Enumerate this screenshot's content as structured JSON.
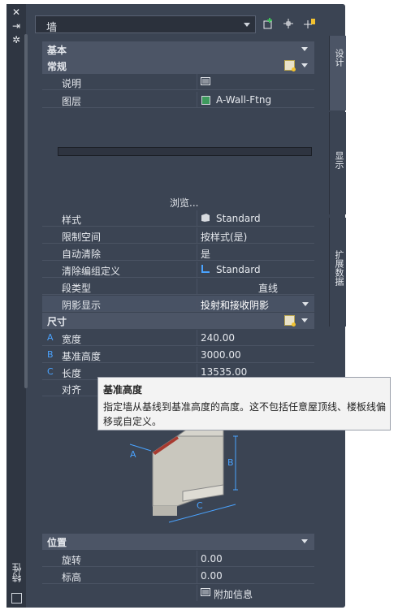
{
  "palette": {
    "title_vertical": "特性",
    "selector": "墙",
    "tabs": [
      "设计",
      "显示",
      "扩展数据"
    ]
  },
  "sections": {
    "basic": "基本",
    "general": "常规",
    "dimensions": "尺寸",
    "location": "位置"
  },
  "general_rows": {
    "description": {
      "key": "说明",
      "value": ""
    },
    "layer": {
      "key": "图层",
      "value": "A-Wall-Ftng"
    },
    "browse": "浏览...",
    "style": {
      "key": "样式",
      "value": "Standard"
    },
    "bound_spaces": {
      "key": "限制空间",
      "value": "按样式(是)"
    },
    "cleanup": {
      "key": "自动清除",
      "value": "是"
    },
    "cleanup_group": {
      "key": "清除编组定义",
      "value": "Standard"
    },
    "segment_type": {
      "key": "段类型",
      "value": "直线"
    },
    "shadow": {
      "key": "阴影显示",
      "value": "投射和接收阴影"
    }
  },
  "dimension_rows": {
    "width": {
      "letter": "A",
      "key": "宽度",
      "value": "240.00"
    },
    "base_height": {
      "letter": "B",
      "key": "基准高度",
      "value": "3000.00"
    },
    "length": {
      "letter": "C",
      "key": "长度",
      "value": "13535.00"
    },
    "justify": {
      "key": "对齐",
      "value": ""
    }
  },
  "location_rows": {
    "rotation": {
      "key": "旋转",
      "value": "0.00"
    },
    "elevation": {
      "key": "标高",
      "value": "0.00"
    },
    "additional": "附加信息"
  },
  "diagram_labels": {
    "a": "A",
    "b": "B",
    "c": "C"
  },
  "tooltip": {
    "title": "基准高度",
    "text": "指定墙从基线到基准高度的高度。这不包括任意屋顶线、楼板线偏移或自定义。"
  },
  "colors": {
    "panel_bg": "#3b4453",
    "header_bg": "#4c5566",
    "accent_letter": "#4aa3ff",
    "layer_swatch": "#3e9a5d"
  }
}
